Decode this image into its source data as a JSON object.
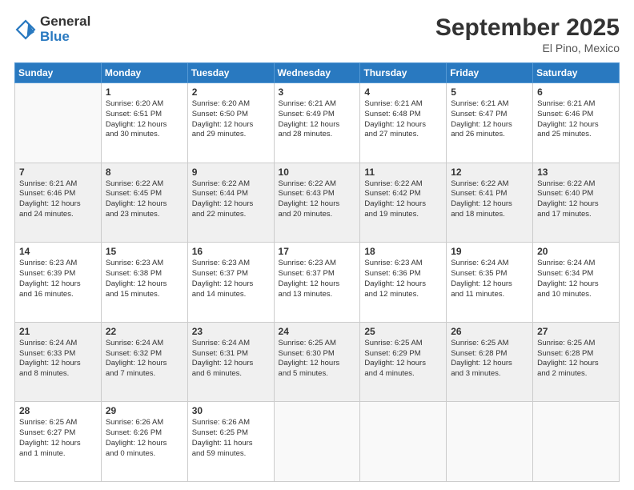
{
  "logo": {
    "line1": "General",
    "line2": "Blue"
  },
  "header": {
    "month": "September 2025",
    "location": "El Pino, Mexico"
  },
  "weekdays": [
    "Sunday",
    "Monday",
    "Tuesday",
    "Wednesday",
    "Thursday",
    "Friday",
    "Saturday"
  ],
  "weeks": [
    [
      {
        "day": "",
        "info": ""
      },
      {
        "day": "1",
        "info": "Sunrise: 6:20 AM\nSunset: 6:51 PM\nDaylight: 12 hours\nand 30 minutes."
      },
      {
        "day": "2",
        "info": "Sunrise: 6:20 AM\nSunset: 6:50 PM\nDaylight: 12 hours\nand 29 minutes."
      },
      {
        "day": "3",
        "info": "Sunrise: 6:21 AM\nSunset: 6:49 PM\nDaylight: 12 hours\nand 28 minutes."
      },
      {
        "day": "4",
        "info": "Sunrise: 6:21 AM\nSunset: 6:48 PM\nDaylight: 12 hours\nand 27 minutes."
      },
      {
        "day": "5",
        "info": "Sunrise: 6:21 AM\nSunset: 6:47 PM\nDaylight: 12 hours\nand 26 minutes."
      },
      {
        "day": "6",
        "info": "Sunrise: 6:21 AM\nSunset: 6:46 PM\nDaylight: 12 hours\nand 25 minutes."
      }
    ],
    [
      {
        "day": "7",
        "info": "Sunrise: 6:21 AM\nSunset: 6:46 PM\nDaylight: 12 hours\nand 24 minutes."
      },
      {
        "day": "8",
        "info": "Sunrise: 6:22 AM\nSunset: 6:45 PM\nDaylight: 12 hours\nand 23 minutes."
      },
      {
        "day": "9",
        "info": "Sunrise: 6:22 AM\nSunset: 6:44 PM\nDaylight: 12 hours\nand 22 minutes."
      },
      {
        "day": "10",
        "info": "Sunrise: 6:22 AM\nSunset: 6:43 PM\nDaylight: 12 hours\nand 20 minutes."
      },
      {
        "day": "11",
        "info": "Sunrise: 6:22 AM\nSunset: 6:42 PM\nDaylight: 12 hours\nand 19 minutes."
      },
      {
        "day": "12",
        "info": "Sunrise: 6:22 AM\nSunset: 6:41 PM\nDaylight: 12 hours\nand 18 minutes."
      },
      {
        "day": "13",
        "info": "Sunrise: 6:22 AM\nSunset: 6:40 PM\nDaylight: 12 hours\nand 17 minutes."
      }
    ],
    [
      {
        "day": "14",
        "info": "Sunrise: 6:23 AM\nSunset: 6:39 PM\nDaylight: 12 hours\nand 16 minutes."
      },
      {
        "day": "15",
        "info": "Sunrise: 6:23 AM\nSunset: 6:38 PM\nDaylight: 12 hours\nand 15 minutes."
      },
      {
        "day": "16",
        "info": "Sunrise: 6:23 AM\nSunset: 6:37 PM\nDaylight: 12 hours\nand 14 minutes."
      },
      {
        "day": "17",
        "info": "Sunrise: 6:23 AM\nSunset: 6:37 PM\nDaylight: 12 hours\nand 13 minutes."
      },
      {
        "day": "18",
        "info": "Sunrise: 6:23 AM\nSunset: 6:36 PM\nDaylight: 12 hours\nand 12 minutes."
      },
      {
        "day": "19",
        "info": "Sunrise: 6:24 AM\nSunset: 6:35 PM\nDaylight: 12 hours\nand 11 minutes."
      },
      {
        "day": "20",
        "info": "Sunrise: 6:24 AM\nSunset: 6:34 PM\nDaylight: 12 hours\nand 10 minutes."
      }
    ],
    [
      {
        "day": "21",
        "info": "Sunrise: 6:24 AM\nSunset: 6:33 PM\nDaylight: 12 hours\nand 8 minutes."
      },
      {
        "day": "22",
        "info": "Sunrise: 6:24 AM\nSunset: 6:32 PM\nDaylight: 12 hours\nand 7 minutes."
      },
      {
        "day": "23",
        "info": "Sunrise: 6:24 AM\nSunset: 6:31 PM\nDaylight: 12 hours\nand 6 minutes."
      },
      {
        "day": "24",
        "info": "Sunrise: 6:25 AM\nSunset: 6:30 PM\nDaylight: 12 hours\nand 5 minutes."
      },
      {
        "day": "25",
        "info": "Sunrise: 6:25 AM\nSunset: 6:29 PM\nDaylight: 12 hours\nand 4 minutes."
      },
      {
        "day": "26",
        "info": "Sunrise: 6:25 AM\nSunset: 6:28 PM\nDaylight: 12 hours\nand 3 minutes."
      },
      {
        "day": "27",
        "info": "Sunrise: 6:25 AM\nSunset: 6:28 PM\nDaylight: 12 hours\nand 2 minutes."
      }
    ],
    [
      {
        "day": "28",
        "info": "Sunrise: 6:25 AM\nSunset: 6:27 PM\nDaylight: 12 hours\nand 1 minute."
      },
      {
        "day": "29",
        "info": "Sunrise: 6:26 AM\nSunset: 6:26 PM\nDaylight: 12 hours\nand 0 minutes."
      },
      {
        "day": "30",
        "info": "Sunrise: 6:26 AM\nSunset: 6:25 PM\nDaylight: 11 hours\nand 59 minutes."
      },
      {
        "day": "",
        "info": ""
      },
      {
        "day": "",
        "info": ""
      },
      {
        "day": "",
        "info": ""
      },
      {
        "day": "",
        "info": ""
      }
    ]
  ]
}
